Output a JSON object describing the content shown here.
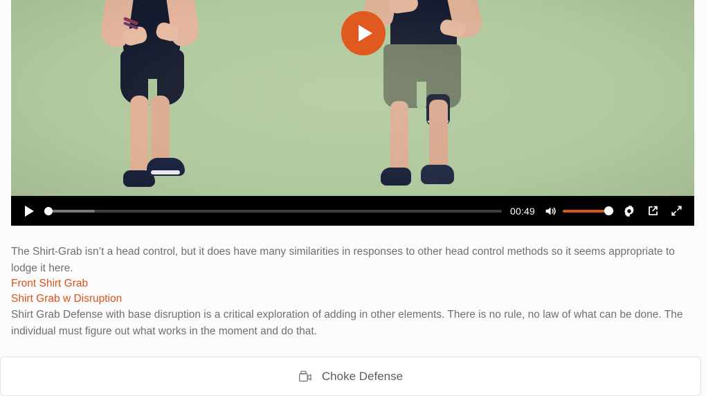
{
  "player": {
    "big_play_label": "Play",
    "controls": {
      "play_label": "Play",
      "seek_label": "Seek",
      "current_time": "00:49",
      "mute_label": "Mute",
      "volume_label": "Volume",
      "volume_percent": 88,
      "seek_percent": 0,
      "buffer_percent": 11,
      "settings_label": "Settings",
      "pip_label": "Enter Picture-in-Picture",
      "fullscreen_label": "Enter fullscreen"
    },
    "accent_color": "#e05a20",
    "volume_fill_color": "#d8531e"
  },
  "content": {
    "paragraph_1": "The Shirt-Grab isn’t a head control, but it does have many similarities in responses to other head control methods so it seems appropriate to lodge it here.",
    "link_1": "Front Shirt Grab",
    "link_2": "Shirt Grab w Disruption",
    "paragraph_2": "Shirt Grab Defense with base disruption is a critical exploration of adding in other elements. There is no rule, no law of what can be done. The individual must figure out what works in the moment and do that.",
    "link_color": "#d9531e",
    "text_color": "#6f6f72"
  },
  "bottom_bar": {
    "icon": "video-camera-icon",
    "label": "Choke Defense"
  }
}
